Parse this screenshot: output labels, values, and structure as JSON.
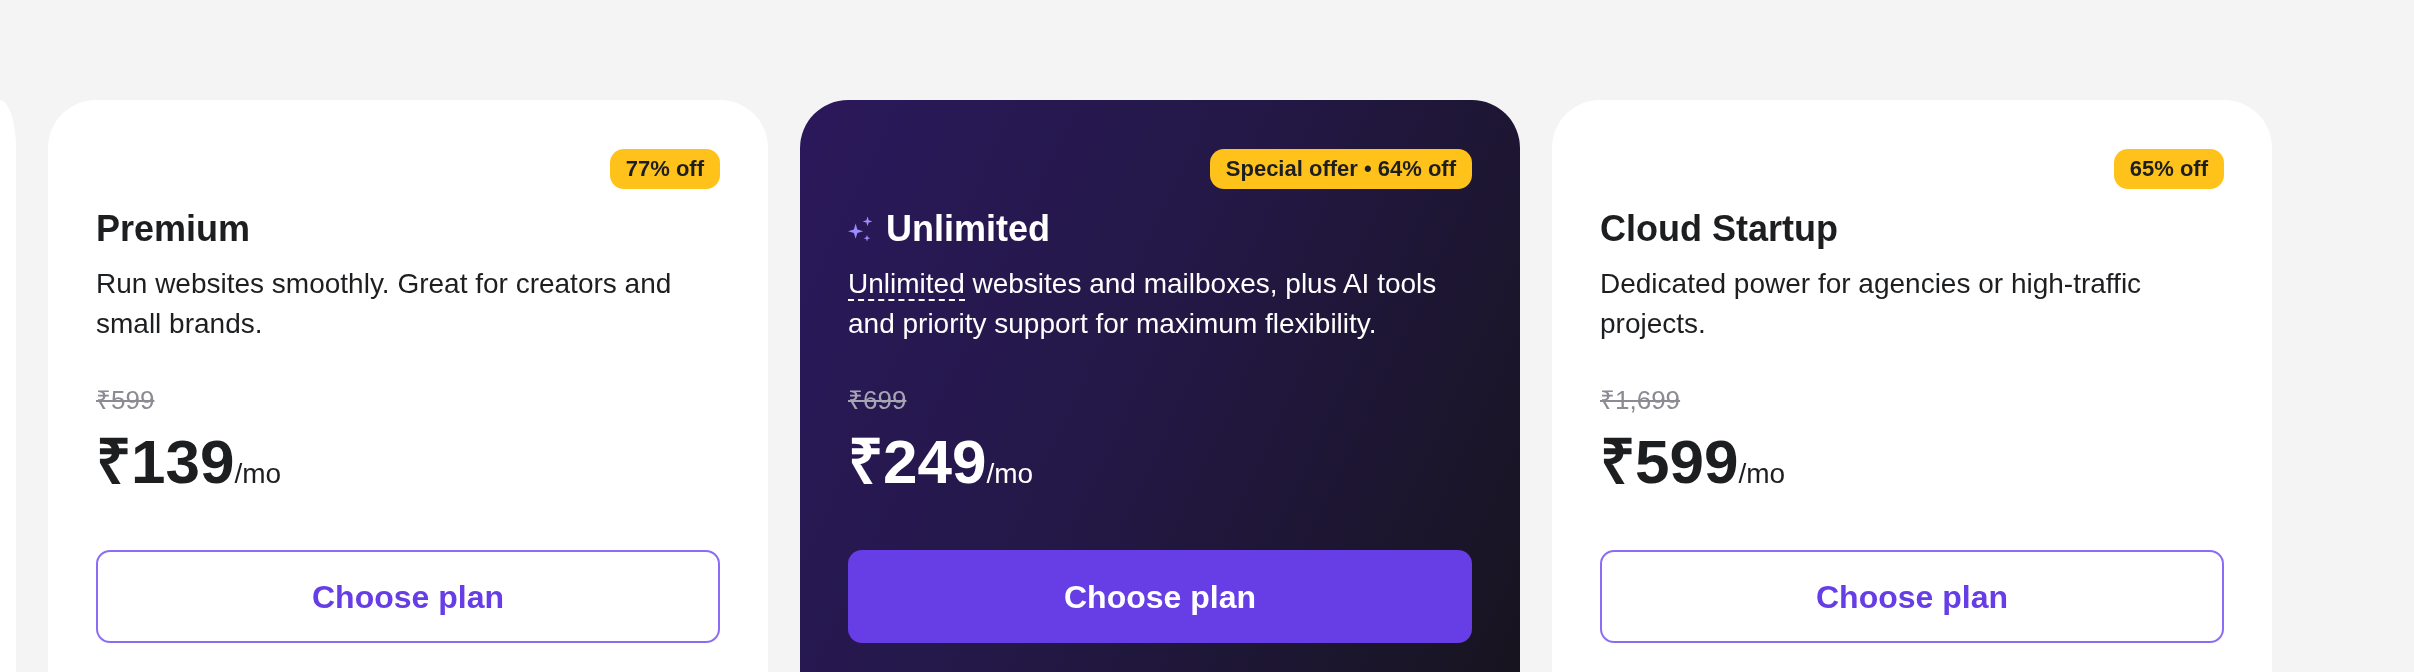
{
  "plans": [
    {
      "name": "Premium",
      "featured": false,
      "badge": "77% off",
      "description": [
        {
          "kind": "plain",
          "text": "Run websites smoothly. Great for creators and small brands."
        }
      ],
      "original_price": "₹599",
      "price": "₹139",
      "period": "/mo",
      "button": "Choose plan"
    },
    {
      "name": "Unlimited",
      "featured": true,
      "badge": "Special offer • 64% off",
      "description": [
        {
          "kind": "term",
          "text": "Unlimited"
        },
        {
          "kind": "plain",
          "text": " websites and mailboxes, plus AI tools and priority support for maximum flexibility."
        }
      ],
      "original_price": "₹699",
      "price": "₹249",
      "period": "/mo",
      "button": "Choose plan"
    },
    {
      "name": "Cloud Startup",
      "featured": false,
      "badge": "65% off",
      "description": [
        {
          "kind": "plain",
          "text": "Dedicated power for agencies or high-traffic projects."
        }
      ],
      "original_price": "₹1,699",
      "price": "₹599",
      "period": "/mo",
      "button": "Choose plan"
    }
  ]
}
